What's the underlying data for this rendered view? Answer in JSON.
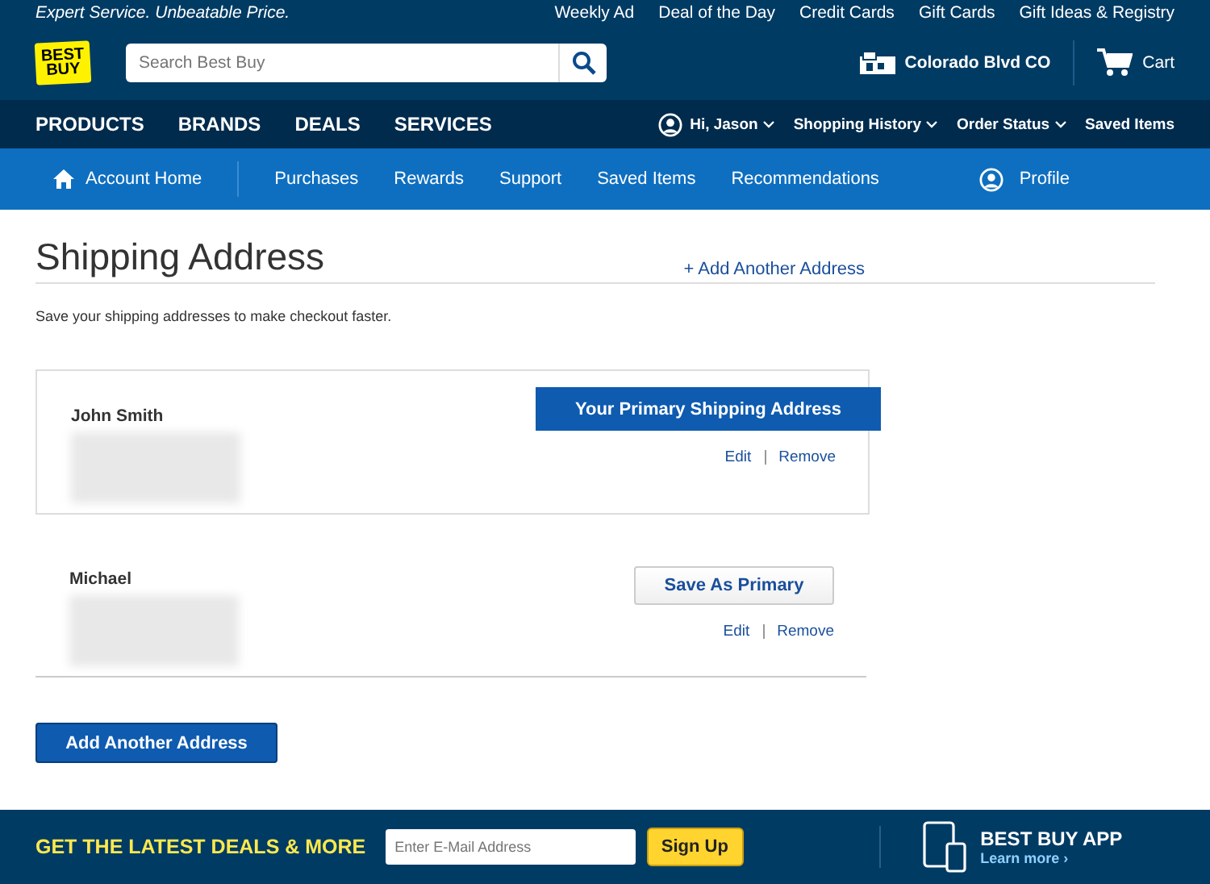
{
  "top_bar": {
    "tagline": "Expert Service. Unbeatable Price.",
    "links": [
      "Weekly Ad",
      "Deal of the Day",
      "Credit Cards",
      "Gift Cards",
      "Gift Ideas & Registry"
    ]
  },
  "header": {
    "logo": "BEST BUY",
    "search": {
      "placeholder": "Search Best Buy"
    },
    "store": "Colorado Blvd CO",
    "cart": "Cart"
  },
  "main_nav": {
    "items": [
      "PRODUCTS",
      "BRANDS",
      "DEALS",
      "SERVICES"
    ],
    "account": "Hi, Jason",
    "menus": [
      {
        "label": "Shopping History",
        "dropdown": true
      },
      {
        "label": "Order Status",
        "dropdown": true
      },
      {
        "label": "Saved Items",
        "dropdown": false
      }
    ]
  },
  "account_nav": {
    "home": "Account Home",
    "items": [
      "Purchases",
      "Rewards",
      "Support",
      "Saved Items",
      "Recommendations"
    ],
    "profile": "Profile"
  },
  "page": {
    "title": "Shipping Address",
    "add_link": "+ Add Another Address",
    "intro": "Save your shipping addresses to make checkout faster."
  },
  "addresses": [
    {
      "name": "John Smith",
      "primary": true,
      "primary_label": "Your Primary Shipping Address",
      "actions": [
        "Edit",
        "Remove"
      ]
    },
    {
      "name": "Michael",
      "primary": false,
      "primary_label": "Save As Primary",
      "actions": [
        "Edit",
        "Remove"
      ]
    }
  ],
  "add_button": "Add Another Address",
  "footer": {
    "promo": "GET THE LATEST DEALS & MORE",
    "email": {
      "placeholder": "Enter E-Mail Address"
    },
    "signup": "Sign Up",
    "app_title": "BEST BUY APP",
    "app_link": "Learn more ›"
  }
}
